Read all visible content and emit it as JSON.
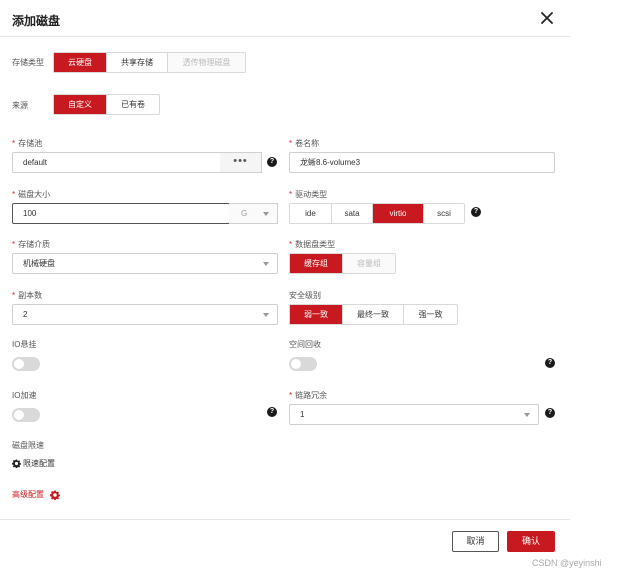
{
  "dialog": {
    "title": "添加磁盘",
    "close_icon": "close-icon"
  },
  "storage_type": {
    "label": "存储类型",
    "options": [
      "云硬盘",
      "共享存储",
      "透传物理磁盘"
    ],
    "selected": "云硬盘"
  },
  "source": {
    "label": "来源",
    "options": [
      "自定义",
      "已有卷"
    ],
    "selected": "自定义"
  },
  "pool": {
    "label": "存储池",
    "value": "default",
    "more_label": "•••"
  },
  "volume_name": {
    "label": "卷名称",
    "value": "龙蜥8.6-volume3"
  },
  "disk_size": {
    "label": "磁盘大小",
    "value": "100",
    "unit": "G"
  },
  "driver_type": {
    "label": "驱动类型",
    "options": [
      "ide",
      "sata",
      "virtio",
      "scsi"
    ],
    "selected": "virtio"
  },
  "storage_medium": {
    "label": "存储介质",
    "value": "机械硬盘"
  },
  "data_disk_type": {
    "label": "数据盘类型",
    "options": [
      "缓存组",
      "容量组"
    ],
    "selected": "缓存组"
  },
  "replicas": {
    "label": "副本数",
    "value": "2"
  },
  "security_level": {
    "label": "安全级别",
    "options": [
      "弱一致",
      "最终一致",
      "强一致"
    ],
    "selected": "弱一致"
  },
  "io_hang": {
    "label": "IO悬挂",
    "enabled": false
  },
  "space_reclaim": {
    "label": "空间回收",
    "enabled": false
  },
  "io_accel": {
    "label": "IO加速",
    "enabled": false
  },
  "link_redundancy": {
    "label": "链路冗余",
    "value": "1"
  },
  "disk_limit": {
    "label": "磁盘限速",
    "link_label": "限速配置"
  },
  "advanced": {
    "label": "高级配置"
  },
  "footer": {
    "cancel_label": "取消",
    "ok_label": "确认"
  },
  "watermark": "CSDN @yeyinshi",
  "colors": {
    "accent": "#c7191f",
    "border": "#d0d0d0"
  }
}
